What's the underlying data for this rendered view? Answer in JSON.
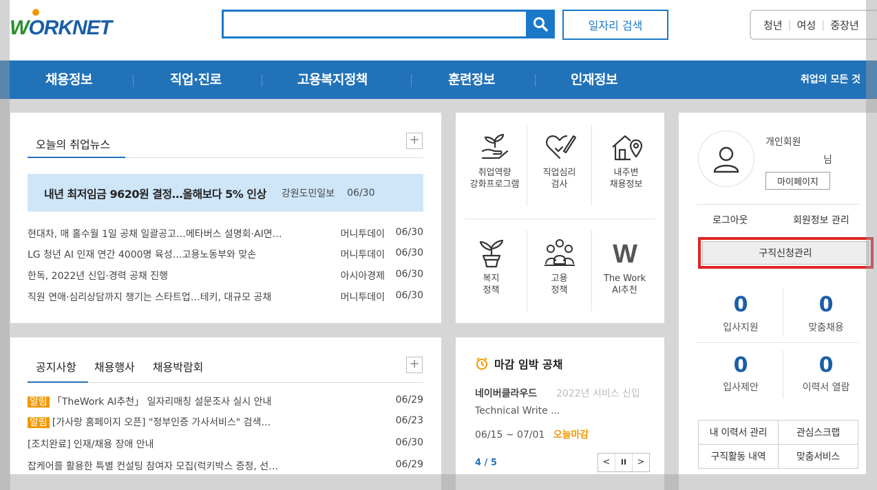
{
  "header": {
    "logo_text": "ORKNET",
    "search_placeholder": "",
    "job_search_label": "일자리 검색",
    "group_links": [
      "청년",
      "여성",
      "중장년"
    ]
  },
  "gnb": {
    "items": [
      "채용정보",
      "직업·진로",
      "고용복지정책",
      "훈련정보",
      "인재정보"
    ],
    "right_label": "취업의 모든 것"
  },
  "news": {
    "title": "오늘의 취업뉴스",
    "plus": "+",
    "headline": {
      "title": "내년 최저임금 9620원 결정…올해보다 5% 인상",
      "source": "강원도민일보",
      "date": "06/30"
    },
    "items": [
      {
        "title": "현대차, 매 홀수월 1일 공채 일괄공고…메타버스 설명회·AI면…",
        "source": "머니투데이",
        "date": "06/30"
      },
      {
        "title": "LG 청년 AI 인재 연간 4000명 육성…고용노동부와 맞손",
        "source": "머니투데이",
        "date": "06/30"
      },
      {
        "title": "한독, 2022년 신입·경력 공채 진행",
        "source": "아시아경제",
        "date": "06/30"
      },
      {
        "title": "직원 연애·심리상담까지 챙기는 스타트업…테키, 대규모 공채",
        "source": "머니투데이",
        "date": "06/30"
      }
    ]
  },
  "notices": {
    "tabs": [
      "공지사항",
      "채용행사",
      "채용박람회"
    ],
    "plus": "+",
    "badge": "알림",
    "items": [
      {
        "badge": true,
        "title": "「TheWork AI추천」 일자리매칭 설문조사 실시 안내",
        "date": "06/29"
      },
      {
        "badge": true,
        "title": "[가사랑 홈페이지 오픈] \"정부인증 가사서비스\" 검색…",
        "date": "06/23"
      },
      {
        "badge": false,
        "title": "[조치완료] 인재/채용 장애 안내",
        "date": "06/30"
      },
      {
        "badge": false,
        "title": "잡케어를 활용한 특별 컨설팅 참여자 모집(럭키박스 증정, 선…",
        "date": "06/29"
      }
    ]
  },
  "services": [
    {
      "label": "취업역량\n강화프로그램",
      "icon": "sprout-hand-icon"
    },
    {
      "label": "직업심리\n검사",
      "icon": "heart-pen-icon"
    },
    {
      "label": "내주변\n채용정보",
      "icon": "house-pin-icon"
    },
    {
      "label": "복지\n정책",
      "icon": "plant-pot-icon"
    },
    {
      "label": "고용\n정책",
      "icon": "people-group-icon"
    },
    {
      "label": "The Work\nAI추천",
      "icon": "w-logo-icon"
    }
  ],
  "deadline": {
    "title": "마감 임박 공채",
    "company": "네이버클라우드",
    "job_overlap": "2022년 서비스 신입",
    "job_line2": "Technical Write ...",
    "period": "06/15 ~ 07/01",
    "status": "오늘마감",
    "page": "4 / 5",
    "prev": "<",
    "pause": "II",
    "next": ">"
  },
  "user": {
    "member_type": "개인회원",
    "name_suffix": "님",
    "mypage": "마이페이지",
    "logout": "로그아웃",
    "manage": "회원정보 관리",
    "job_request": "구직신청관리",
    "counts": [
      {
        "value": "0",
        "label": "입사지원"
      },
      {
        "value": "0",
        "label": "맞춤채용"
      },
      {
        "value": "0",
        "label": "입사제안"
      },
      {
        "value": "0",
        "label": "이력서 열람"
      }
    ],
    "links": [
      "내 이력서 관리",
      "관심스크랩",
      "구직활동 내역",
      "맞춤서비스"
    ]
  },
  "colors": {
    "brand": "#2272b8",
    "highlight_box": "#e02424",
    "accent": "#f39800"
  }
}
